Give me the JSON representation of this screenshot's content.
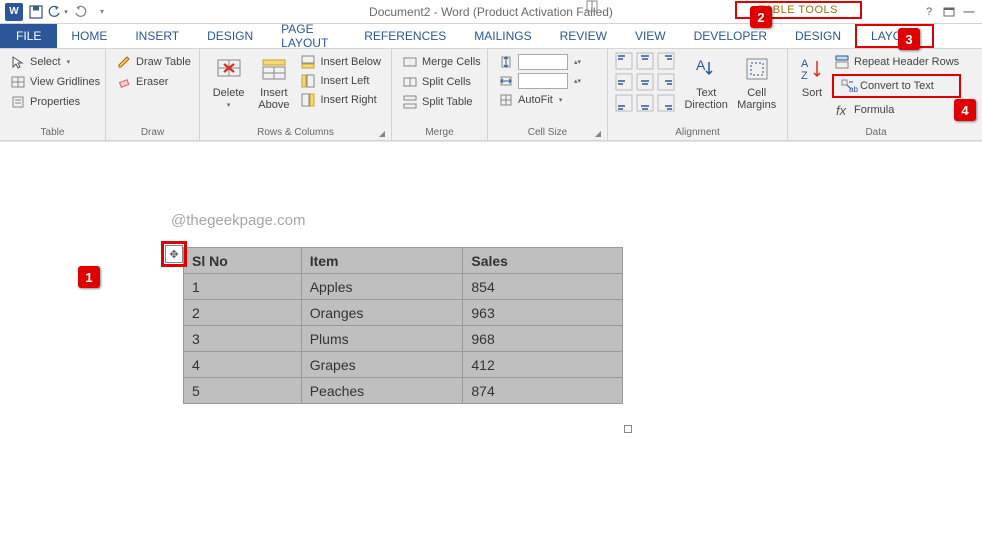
{
  "title": "Document2 - Word (Product Activation Failed)",
  "table_tools_label": "TABLE TOOLS",
  "tabs": {
    "file": "FILE",
    "home": "HOME",
    "insert": "INSERT",
    "design": "DESIGN",
    "page_layout": "PAGE LAYOUT",
    "references": "REFERENCES",
    "mailings": "MAILINGS",
    "review": "REVIEW",
    "view": "VIEW",
    "developer": "DEVELOPER",
    "tt_design": "DESIGN",
    "tt_layout": "LAYOUT"
  },
  "groups": {
    "table": {
      "label": "Table",
      "select": "Select",
      "gridlines": "View Gridlines",
      "properties": "Properties"
    },
    "draw": {
      "label": "Draw",
      "draw_table": "Draw Table",
      "eraser": "Eraser"
    },
    "rows_cols": {
      "label": "Rows & Columns",
      "delete": "Delete",
      "insert_above": "Insert Above",
      "insert_below": "Insert Below",
      "insert_left": "Insert Left",
      "insert_right": "Insert Right"
    },
    "merge": {
      "label": "Merge",
      "merge_cells": "Merge Cells",
      "split_cells": "Split Cells",
      "split_table": "Split Table"
    },
    "cell_size": {
      "label": "Cell Size",
      "autofit": "AutoFit"
    },
    "alignment": {
      "label": "Alignment",
      "text_direction": "Text Direction",
      "cell_margins": "Cell Margins"
    },
    "data": {
      "label": "Data",
      "sort": "Sort",
      "repeat_header": "Repeat Header Rows",
      "convert_to_text": "Convert to Text",
      "formula": "Formula"
    }
  },
  "callouts": {
    "c1": "1",
    "c2": "2",
    "c3": "3",
    "c4": "4"
  },
  "watermark": "@thegeekpage.com",
  "chart_data": {
    "type": "table",
    "headers": [
      "Sl No",
      "Item",
      "Sales"
    ],
    "rows": [
      [
        "1",
        "Apples",
        "854"
      ],
      [
        "2",
        "Oranges",
        "963"
      ],
      [
        "3",
        "Plums",
        "968"
      ],
      [
        "4",
        "Grapes",
        "412"
      ],
      [
        "5",
        "Peaches",
        "874"
      ]
    ]
  }
}
